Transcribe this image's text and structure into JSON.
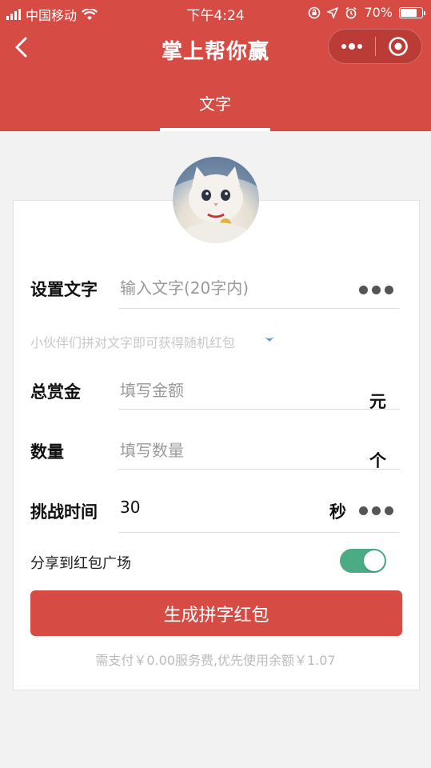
{
  "status_bar": {
    "carrier": "中国移动",
    "time": "下午4:24",
    "battery": "70%"
  },
  "nav": {
    "title": "掌上帮你赢"
  },
  "tabs": [
    {
      "label": "文字",
      "active": true
    }
  ],
  "form": {
    "text_row": {
      "label": "设置文字",
      "placeholder": "输入文字(20字内)"
    },
    "hint": "小伙伴们拼对文字即可获得随机红包",
    "amount_row": {
      "label": "总赏金",
      "placeholder": "填写金额",
      "unit": "元"
    },
    "count_row": {
      "label": "数量",
      "placeholder": "填写数量",
      "unit": "个"
    },
    "time_row": {
      "label": "挑战时间",
      "value": "30",
      "unit": "秒"
    },
    "share": {
      "label": "分享到红包广场",
      "enabled": true
    },
    "submit_label": "生成拼字红包",
    "fee_note": "需支付￥0.00服务费,优先使用余额￥1.07"
  },
  "colors": {
    "brand": "#d64c45",
    "toggle_on": "#4aab85",
    "help_icon": "#5b9bd1"
  }
}
